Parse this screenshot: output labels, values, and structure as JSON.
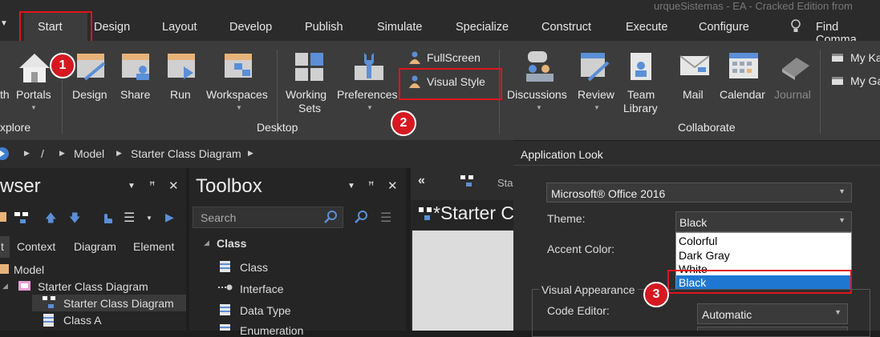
{
  "window": {
    "title_fragment": "urqueSistemas - EA - Cracked Edition from"
  },
  "tabs": {
    "start": "Start",
    "design": "Design",
    "layout": "Layout",
    "develop": "Develop",
    "publish": "Publish",
    "simulate": "Simulate",
    "specialize": "Specialize",
    "construct": "Construct",
    "execute": "Execute",
    "configure": "Configure",
    "find": "Find Comma"
  },
  "ribbon": {
    "explore": {
      "portals_label": "Portals",
      "path_label": "th",
      "group": "xplore"
    },
    "desktop": {
      "design": "Design",
      "share": "Share",
      "run": "Run",
      "workspaces": "Workspaces",
      "working_sets_1": "Working",
      "working_sets_2": "Sets",
      "preferences": "Preferences",
      "fullscreen": "FullScreen",
      "visual_style": "Visual Style",
      "group": "Desktop"
    },
    "collaborate": {
      "discussions": "Discussions",
      "review": "Review",
      "team_1": "Team",
      "team_2": "Library",
      "mail": "Mail",
      "calendar": "Calendar",
      "journal": "Journal",
      "group": "Collaborate"
    },
    "my": {
      "item1": "My Ka",
      "item2": "My Ga"
    }
  },
  "breadcrumb": {
    "sep": "/",
    "model": "Model",
    "diagram": "Starter Class Diagram"
  },
  "browser": {
    "title": "wser",
    "tabs": {
      "t1": "t",
      "context": "Context",
      "diagram": "Diagram",
      "element": "Element"
    },
    "tree": {
      "model": "Model",
      "pkg": "Starter Class Diagram",
      "diag": "Starter Class Diagram",
      "classA": "Class A"
    }
  },
  "toolbox": {
    "title": "Toolbox",
    "search_placeholder": "Search",
    "section": "Class",
    "items": {
      "class": "Class",
      "interface": "Interface",
      "datatype": "Data Type",
      "enumeration": "Enumeration"
    }
  },
  "diagram": {
    "tab_frag": "Sta",
    "title": "*Starter C"
  },
  "dialog": {
    "title": "Application Look",
    "look_value": "Microsoft® Office 2016",
    "theme_label": "Theme:",
    "theme_value": "Black",
    "accent_label": "Accent Color:",
    "options": [
      "Colorful",
      "Dark Gray",
      "White",
      "Black"
    ],
    "visual_appearance": "Visual Appearance",
    "code_editor_label": "Code Editor:",
    "code_editor_value": "Automatic"
  },
  "annotations": {
    "b1": "1",
    "b2": "2",
    "b3": "3"
  },
  "colors": {
    "highlight_red": "#e1141d",
    "selection_blue": "#1e78d2",
    "panel_dark": "#252526"
  }
}
